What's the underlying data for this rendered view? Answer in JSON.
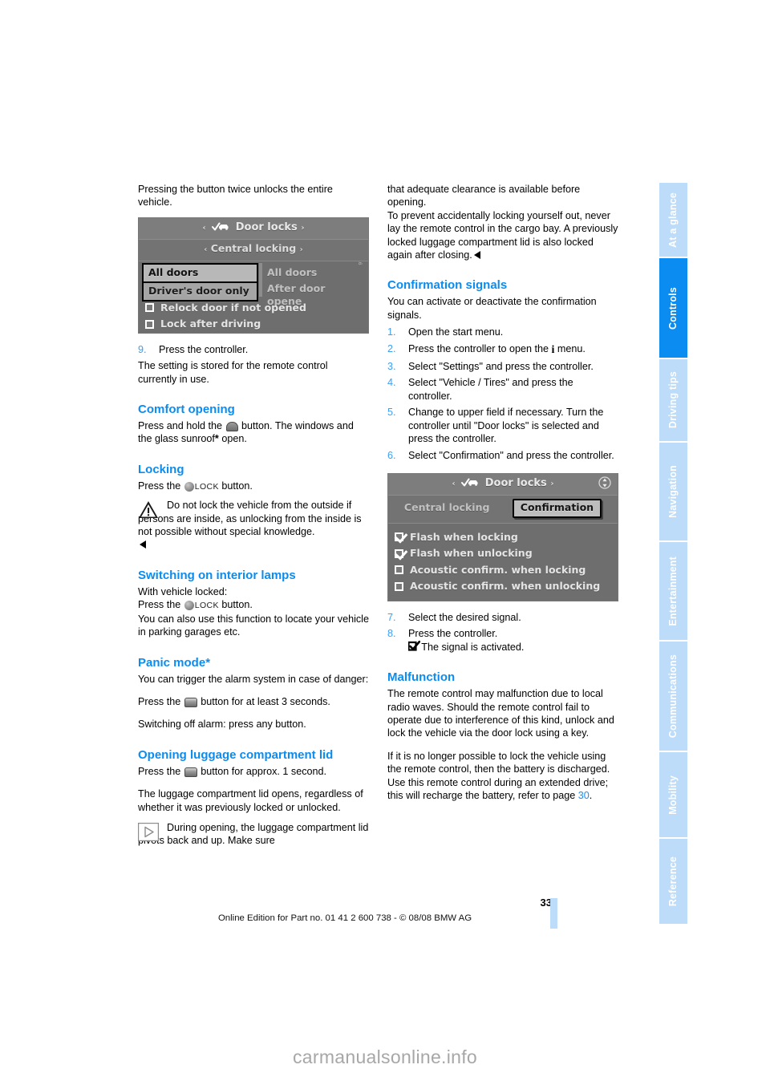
{
  "page": {
    "number": "33",
    "edition_line": "Online Edition for Part no. 01 41 2 600 738 - © 08/08 BMW AG",
    "watermark": "carmanualsonline.info",
    "accent_blue": "#0a8cf0",
    "tab_inactive": "#bcdcfa"
  },
  "tabs": [
    {
      "label": "At a glance",
      "active": false
    },
    {
      "label": "Controls",
      "active": true
    },
    {
      "label": "Driving tips",
      "active": false
    },
    {
      "label": "Navigation",
      "active": false
    },
    {
      "label": "Entertainment",
      "active": false
    },
    {
      "label": "Communications",
      "active": false
    },
    {
      "label": "Mobility",
      "active": false
    },
    {
      "label": "Reference",
      "active": false
    }
  ],
  "left_column": {
    "intro": "Pressing the button twice unlocks the entire vehicle.",
    "figure_door_locks": {
      "image_id": "VET5151A6",
      "title": "Door locks",
      "subtitle": "Central locking",
      "left_arrow": "‹",
      "right_arrow": "›",
      "background_rows": [
        {
          "label": "All doors",
          "checked": false
        },
        {
          "label": "After door opene",
          "checked": false
        },
        {
          "label": "Relock door if not opened",
          "checked": false
        },
        {
          "label": "Lock after driving",
          "checked": false
        }
      ],
      "dropdown": {
        "selected": "All doors",
        "options": [
          "All doors",
          "Driver's door only"
        ]
      }
    },
    "step9": {
      "num": "9.",
      "text": "Press the controller."
    },
    "step9_note": "The setting is stored for the remote control currently in use.",
    "comfort_opening": {
      "heading": "Comfort opening",
      "text_before_icon": "Press and hold the",
      "icon": "sunroof-button-icon",
      "text_after_icon": "button. The windows and the glass sunroof",
      "asterisk": "*",
      "text_end": "open."
    },
    "locking": {
      "heading": "Locking",
      "press_before": "Press the",
      "lock_word": "LOCK",
      "press_after": "button.",
      "warning": "Do not lock the vehicle from the outside if persons are inside, as unlocking from the inside is not possible without special knowledge."
    },
    "interior_lamps": {
      "heading": "Switching on interior lamps",
      "line1": "With vehicle locked:",
      "press_before": "Press the",
      "lock_word": "LOCK",
      "press_after": "button.",
      "line3": "You can also use this function to locate your vehicle in parking garages etc."
    },
    "panic_mode": {
      "heading": "Panic mode*",
      "line1": "You can trigger the alarm system in case of danger:",
      "press_before": "Press the",
      "press_after": "button for at least 3 seconds.",
      "line3": "Switching off alarm: press any button."
    },
    "luggage_lid": {
      "heading": "Opening luggage compartment lid",
      "press_before": "Press the",
      "press_after": "button for approx. 1 second.",
      "line2": "The luggage compartment lid opens, regardless of whether it was previously locked or unlocked.",
      "note": "During opening, the luggage compartment lid pivots back and up. Make sure"
    }
  },
  "right_column": {
    "note_continued": "that adequate clearance is available before opening.",
    "note_continued2": "To prevent accidentally locking yourself out, never lay the remote control in the cargo bay. A previously locked luggage compartment lid is also locked again after closing.",
    "confirmation_signals": {
      "heading": "Confirmation signals",
      "intro": "You can activate or deactivate the confirmation signals.",
      "steps": [
        {
          "num": "1.",
          "text": "Open the start menu."
        },
        {
          "num": "2.",
          "text_before": "Press the controller to open the",
          "icon": "info-i-icon",
          "text_after": "menu."
        },
        {
          "num": "3.",
          "text": "Select \"Settings\" and press the controller."
        },
        {
          "num": "4.",
          "text": "Select \"Vehicle / Tires\" and press the controller."
        },
        {
          "num": "5.",
          "text": "Change to upper field if necessary. Turn the controller until \"Door locks\" is selected and press the controller."
        },
        {
          "num": "6.",
          "text": "Select \"Confirmation\" and press the controller."
        }
      ]
    },
    "figure_confirmation": {
      "image_id": "VET5151B5",
      "title": "Door locks",
      "left_arrow": "‹",
      "right_arrow": "›",
      "tab_inactive": "Central locking",
      "tab_selected": "Confirmation",
      "rows": [
        {
          "label": "Flash when locking",
          "checked": true
        },
        {
          "label": "Flash when unlocking",
          "checked": true
        },
        {
          "label": "Acoustic confirm. when locking",
          "checked": false
        },
        {
          "label": "Acoustic confirm. when unlocking",
          "checked": false
        }
      ]
    },
    "steps_after": [
      {
        "num": "7.",
        "text": "Select the desired signal."
      },
      {
        "num": "8.",
        "text": "Press the controller."
      }
    ],
    "signal_activated": "The signal is activated.",
    "malfunction": {
      "heading": "Malfunction",
      "para1": "The remote control may malfunction due to local radio waves. Should the remote control fail to operate due to interference of this kind, unlock and lock the vehicle via the door lock using a key.",
      "para2_before": "If it is no longer possible to lock the vehicle using the remote control, then the battery is discharged. Use this remote control during an extended drive; this will recharge the battery, refer to page",
      "page_ref": "30",
      "para2_after": "."
    }
  }
}
